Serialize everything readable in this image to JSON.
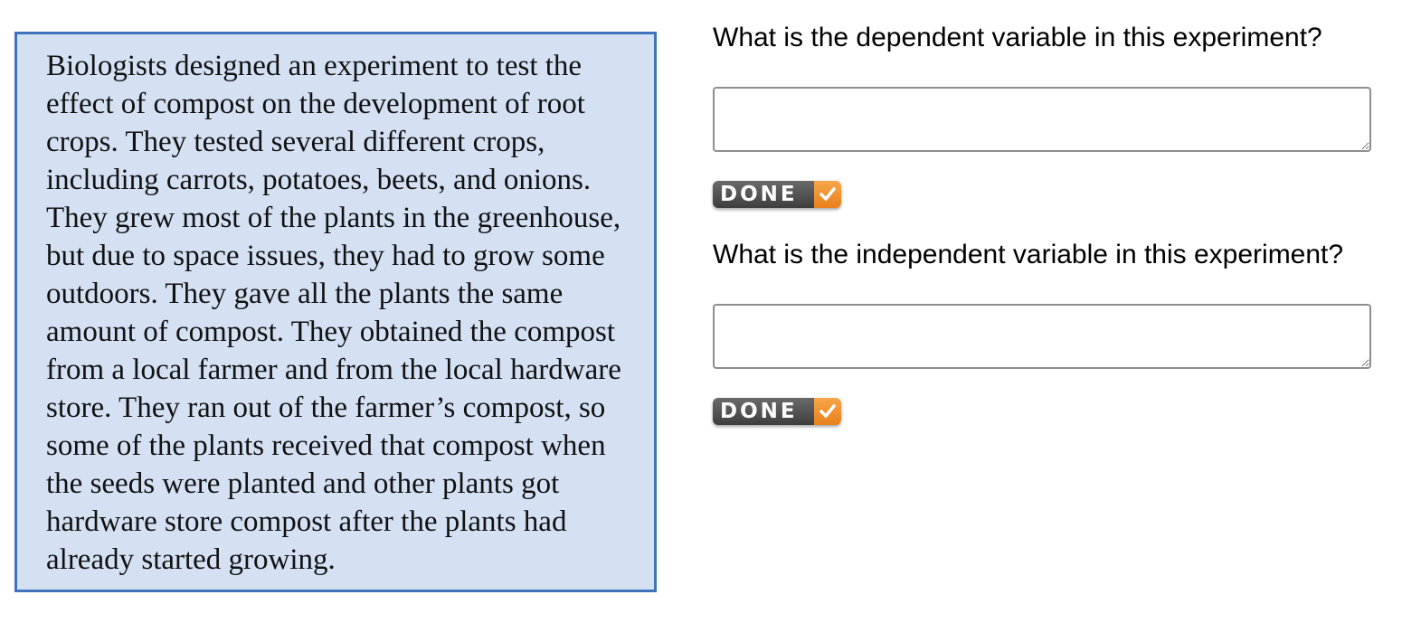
{
  "passage": {
    "text": "Biologists designed an experiment to test the effect of compost on the development of root crops. They tested several different crops, including carrots, potatoes, beets, and onions. They grew most of the plants in the greenhouse, but due to space issues, they had to grow some outdoors. They gave all the plants the same amount of compost. They obtained the compost from a local farmer and from the local hardware store. They ran out of the farmer’s compost, so some of the plants received that compost when the seeds were planted and other plants got hardware store compost after the plants had already started growing."
  },
  "questions": [
    {
      "prompt": "What is the dependent variable in this experiment?",
      "answer": "",
      "done_label": "DONE"
    },
    {
      "prompt": "What is the independent variable in this experiment?",
      "answer": "",
      "done_label": "DONE"
    }
  ],
  "colors": {
    "passage_background": "#d3e1f3",
    "passage_border": "#3f73bc",
    "done_button_dark": "#4a4a4a",
    "done_button_accent": "#f0922f"
  },
  "icons": {
    "done_check": "checkmark-icon",
    "resize_grip": "resize-handle-icon"
  }
}
